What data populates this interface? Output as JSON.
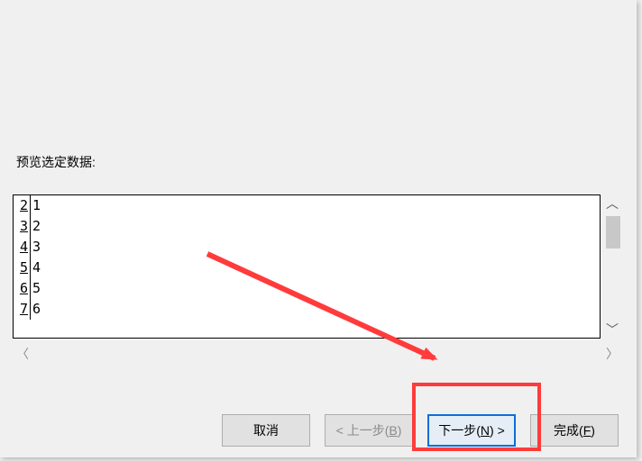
{
  "label": "预览选定数据:",
  "rows": [
    {
      "lineno": "2",
      "val": "1"
    },
    {
      "lineno": "3",
      "val": "2"
    },
    {
      "lineno": "4",
      "val": "3"
    },
    {
      "lineno": "5",
      "val": "4"
    },
    {
      "lineno": "6",
      "val": "5"
    },
    {
      "lineno": "7",
      "val": "6"
    }
  ],
  "buttons": {
    "cancel": "取消",
    "back_prefix": "< 上一步(",
    "back_mnemonic": "B",
    "back_suffix": ")",
    "next_prefix": "下一步(",
    "next_mnemonic": "N",
    "next_suffix": ") >",
    "finish_prefix": "完成(",
    "finish_mnemonic": "F",
    "finish_suffix": ")"
  }
}
